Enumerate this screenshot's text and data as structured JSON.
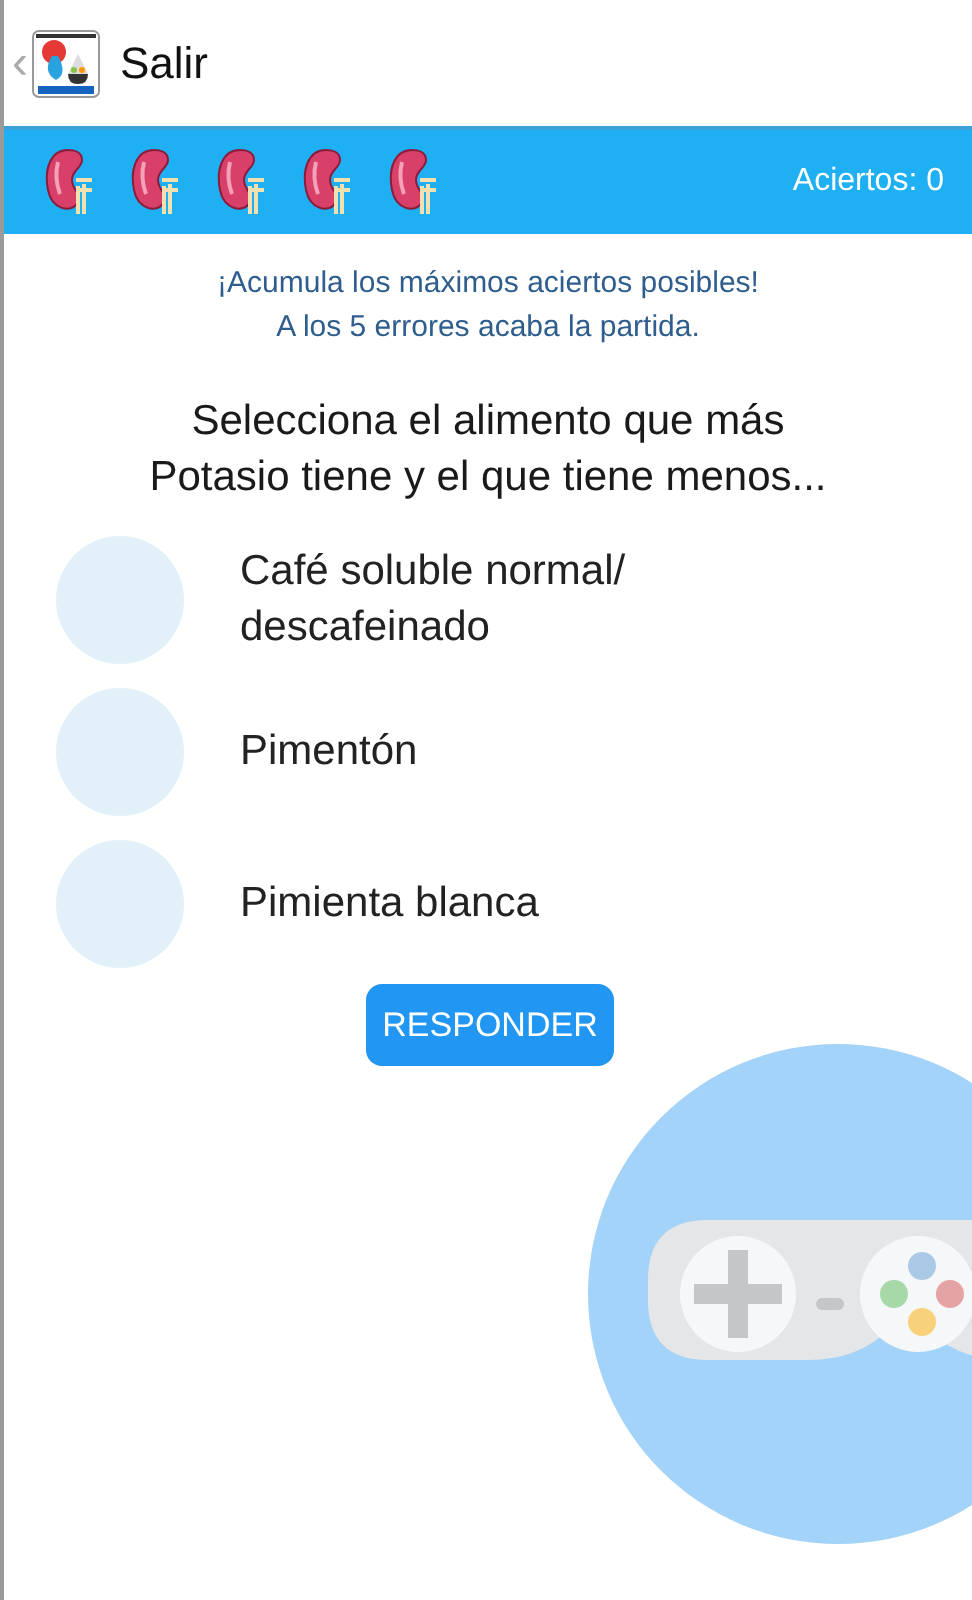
{
  "header": {
    "back": "‹",
    "title": "Salir"
  },
  "lives": [
    {
      "active": true
    },
    {
      "active": true
    },
    {
      "active": true
    },
    {
      "active": true
    },
    {
      "active": true
    }
  ],
  "score": "Aciertos: 0",
  "instructions": [
    "¡Acumula los máximos aciertos posibles!",
    "A los 5 errores acaba la partida."
  ],
  "question": "Selecciona el alimento que más Potasio tiene y el que tiene menos...",
  "options": [
    {
      "label": "Café soluble normal/ descafeinado",
      "selected": false
    },
    {
      "label": "Pimentón",
      "selected": false
    },
    {
      "label": "Pimienta blanca",
      "selected": false
    }
  ],
  "submit": "RESPONDER"
}
